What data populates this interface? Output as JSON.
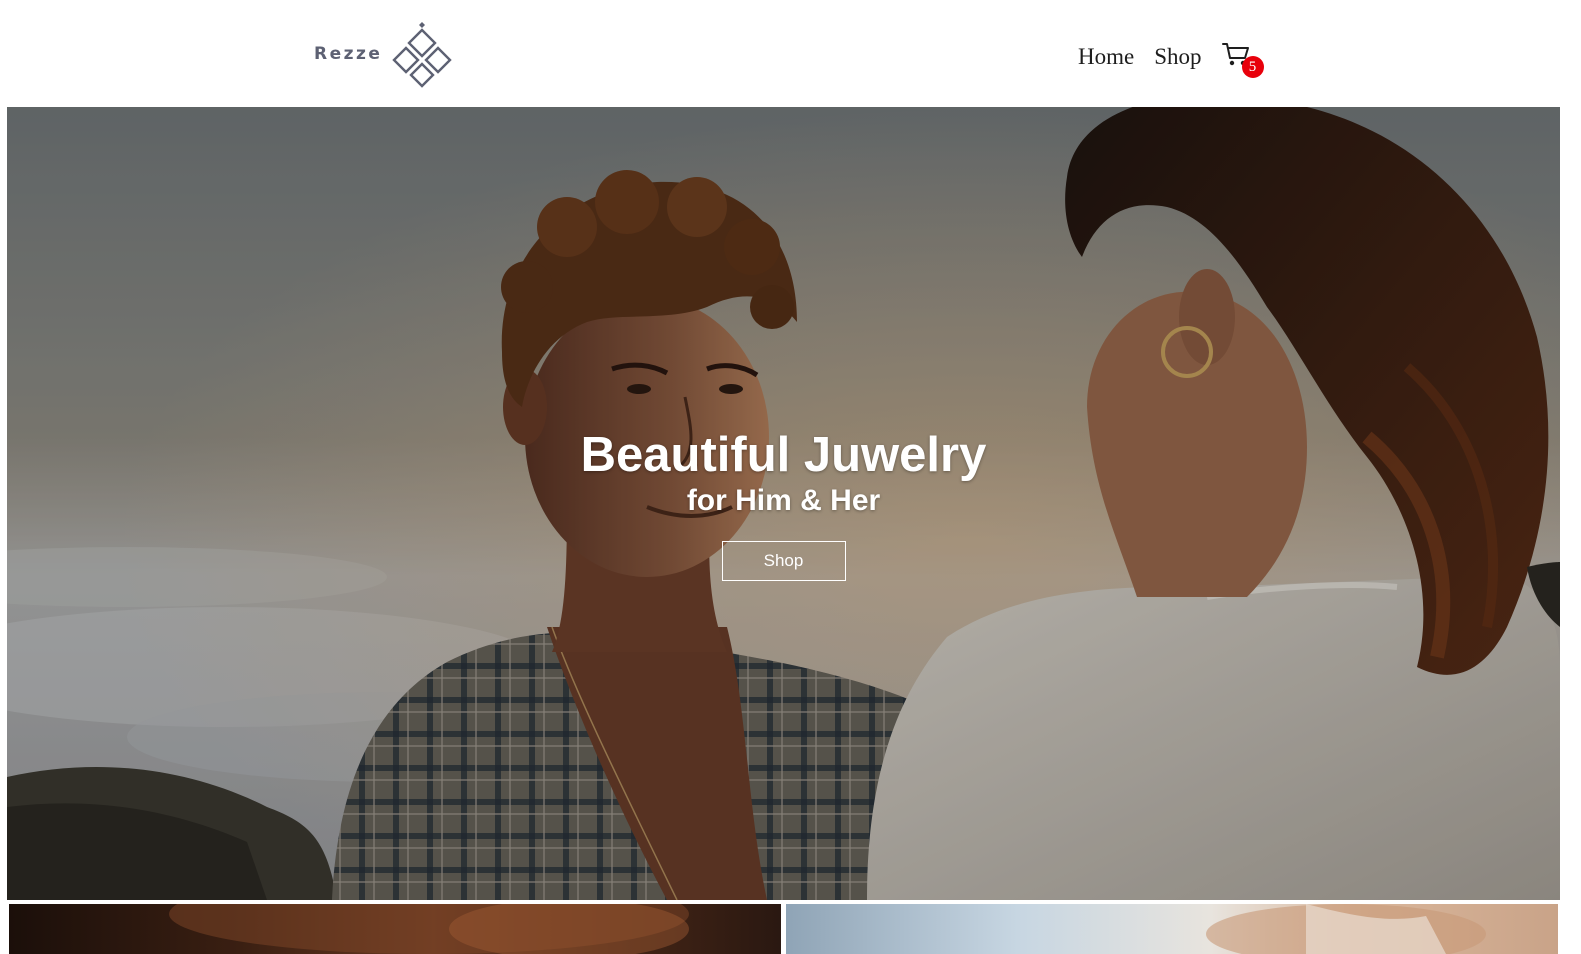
{
  "brand": {
    "name": "Rezze",
    "logo_icon": "diamond-lattice-icon",
    "text_color": "#5d6173"
  },
  "nav": {
    "links": [
      {
        "label": "Home"
      },
      {
        "label": "Shop"
      }
    ],
    "cart": {
      "icon": "shopping-cart-icon",
      "count": "5",
      "badge_color": "#e8000b"
    }
  },
  "hero": {
    "title": "Beautiful Juwelry",
    "subtitle": "for Him & Her",
    "button_label": "Shop",
    "background_image": "couple-on-mountain-photo"
  },
  "tiles": [
    {
      "image": "warm-portrait-photo"
    },
    {
      "image": "bright-portrait-photo"
    }
  ]
}
